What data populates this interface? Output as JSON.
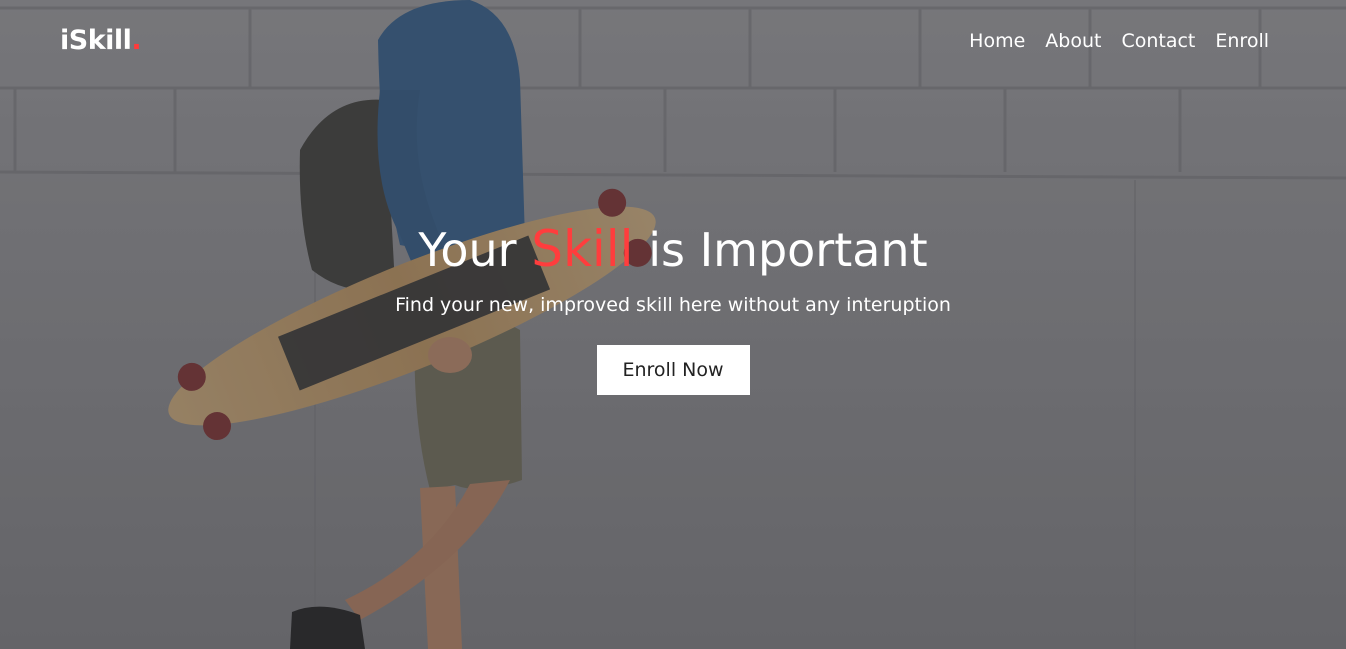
{
  "brand": {
    "name": "iSkill",
    "dot": ".",
    "accent_color": "#ff3b3b"
  },
  "nav": {
    "items": [
      {
        "label": "Home"
      },
      {
        "label": "About"
      },
      {
        "label": "Contact"
      },
      {
        "label": "Enroll"
      }
    ]
  },
  "hero": {
    "headline_before": "Your ",
    "headline_highlight": "Skill",
    "headline_after": " is Important",
    "subtitle": "Find your new, improved skill here without any interuption",
    "cta_label": "Enroll Now",
    "background_image": "person-walking-with-longboard-against-brick-wall"
  }
}
